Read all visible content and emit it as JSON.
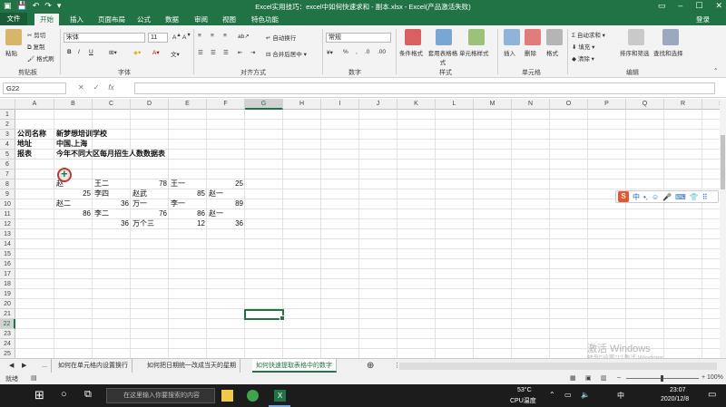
{
  "window": {
    "title": "Excel实用技巧：excel中如何快速求和 - 副本.xlsx - Excel(产品激活失败)",
    "login": "登录"
  },
  "tabs": [
    "文件",
    "开始",
    "插入",
    "页面布局",
    "公式",
    "数据",
    "审阅",
    "视图",
    "特色功能"
  ],
  "ribbon": {
    "clipboard": {
      "paste": "粘贴",
      "cut": "剪切",
      "copy": "复制",
      "format_painter": "格式刷",
      "label": "剪贴板"
    },
    "font": {
      "name": "宋体",
      "size": "11",
      "label": "字体"
    },
    "alignment": {
      "wrap": "自动换行",
      "merge": "合并后居中",
      "label": "对齐方式"
    },
    "number": {
      "format": "常规",
      "label": "数字"
    },
    "styles": {
      "conditional": "条件格式",
      "table": "套用表格格式",
      "cell": "单元格样式",
      "label": "样式"
    },
    "cells": {
      "insert": "插入",
      "delete": "删除",
      "format": "格式",
      "label": "单元格"
    },
    "editing": {
      "autosum": "自动求和",
      "fill": "填充",
      "clear": "清除",
      "sort": "排序和筛选",
      "find": "查找和选择",
      "label": "编辑"
    }
  },
  "formula_bar": {
    "name_box": "G22",
    "cancel": "✕",
    "enter": "✓",
    "fx": "fx",
    "value": ""
  },
  "columns": [
    "A",
    "B",
    "C",
    "D",
    "E",
    "F",
    "G",
    "H",
    "I",
    "J",
    "K",
    "L",
    "M",
    "N",
    "O",
    "P",
    "Q",
    "R",
    "S"
  ],
  "rows": [
    "1",
    "2",
    "3",
    "4",
    "5",
    "6",
    "7",
    "8",
    "9",
    "10",
    "11",
    "12",
    "13",
    "14",
    "15",
    "16",
    "17",
    "18",
    "19",
    "20",
    "21",
    "22",
    "23",
    "24",
    "25",
    "26"
  ],
  "selected_cell": {
    "col": "G",
    "row": "22"
  },
  "cells": {
    "a3": "公司名称",
    "b3": "新梦想培训学校",
    "a4": "地址",
    "b4": "中国,上海",
    "a5": "报表",
    "b5": "今年不同大区每月招生人数数据表",
    "b8": "赵",
    "c8": "王二",
    "d8": "78",
    "e8": "王一",
    "f8": "25",
    "b9": "25",
    "c9": "李四",
    "d9": "赵武",
    "e9": "85",
    "f9": "赵一",
    "a10": "赵二",
    "c10": "36",
    "d10": "万一",
    "e10": "李一",
    "f10": "89",
    "b11": "86",
    "c11": "李二",
    "d11": "76",
    "e11": "86",
    "f11": "赵一",
    "c12": "36",
    "d12": "万个三",
    "e12": "12",
    "f12": "36"
  },
  "sheet_tabs": [
    "...",
    "如何在单元格内设置换行",
    "如何把日期统一改成当天的星期",
    "如何快速提取表格中的数字"
  ],
  "active_sheet": 3,
  "status": {
    "mode": "就绪",
    "zoom": "100%"
  },
  "ime": {
    "logo": "S",
    "mode": "中"
  },
  "watermark": {
    "line1": "激活 Windows",
    "line2": "转到\"设置\"以激活 Windows。"
  },
  "taskbar": {
    "search_placeholder": "在这里输入你要搜索的内容",
    "weather": "53°C",
    "weather_sub": "CPU温度",
    "time": "23:07",
    "date": "2020/12/8"
  }
}
